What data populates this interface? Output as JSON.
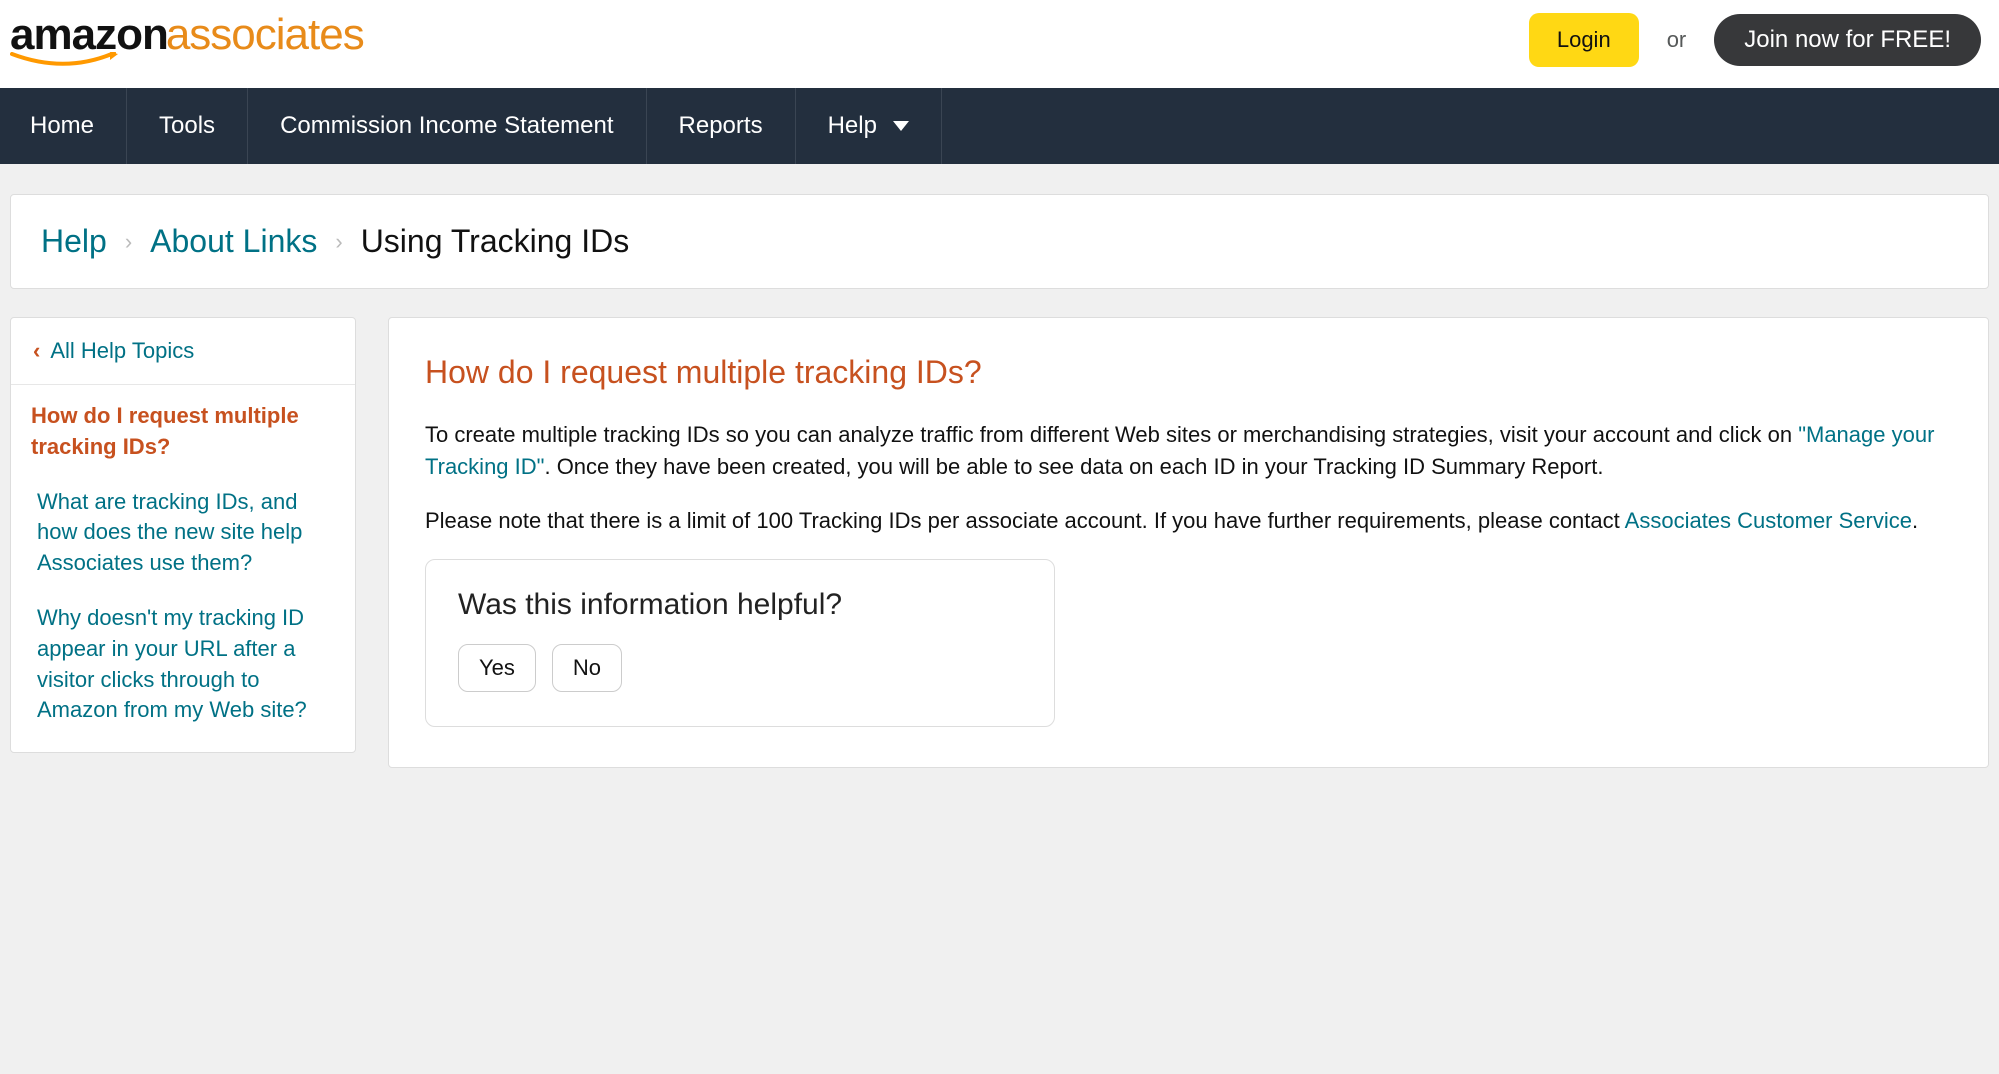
{
  "header": {
    "logo_main": "amazon",
    "logo_sub": "associates",
    "login": "Login",
    "or": "or",
    "join": "Join now for FREE!"
  },
  "nav": {
    "items": [
      "Home",
      "Tools",
      "Commission Income Statement",
      "Reports",
      "Help"
    ]
  },
  "breadcrumb": {
    "items": [
      "Help",
      "About Links"
    ],
    "current": "Using Tracking IDs"
  },
  "sidebar": {
    "back": "All Help Topics",
    "items": [
      {
        "label": "How do I request multiple tracking IDs?",
        "active": true
      },
      {
        "label": "What are tracking IDs, and how does the new site help Associates use them?",
        "active": false
      },
      {
        "label": "Why doesn't my tracking ID appear in your URL after a visitor clicks through to Amazon from my Web site?",
        "active": false
      }
    ]
  },
  "article": {
    "title": "How do I request multiple tracking IDs?",
    "p1_a": "To create multiple tracking IDs so you can analyze traffic from different Web sites or merchandising strategies, visit your account and click on ",
    "p1_link": "\"Manage your Tracking ID\"",
    "p1_b": ". Once they have been created, you will be able to see data on each ID in your Tracking ID Summary Report.",
    "p2_a": "Please note that there is a limit of 100 Tracking IDs per associate account. If you have further requirements, please contact ",
    "p2_link": "Associates Customer Service",
    "p2_b": "."
  },
  "feedback": {
    "question": "Was this information helpful?",
    "yes": "Yes",
    "no": "No"
  }
}
